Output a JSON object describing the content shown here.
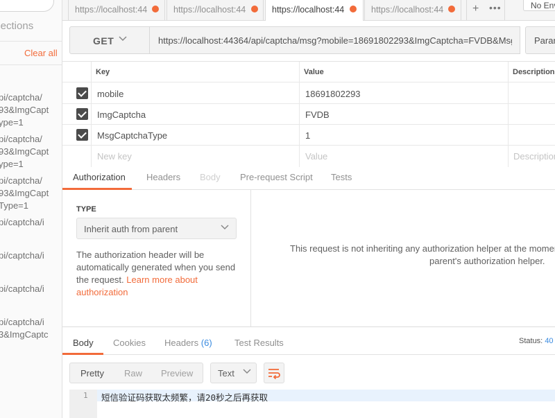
{
  "sidebar": {
    "collections_label": "llections",
    "clear_all_label": "Clear all",
    "history_lines": [
      "pi/captcha/",
      "93&ImgCapt",
      "ype=1",
      "pi/captcha/",
      "93&ImgCapt",
      "ype=1",
      "pi/captcha/",
      "93&ImgCapt",
      "Type=1",
      "pi/captcha/i",
      "pi/captcha/i",
      "pi/captcha/i",
      "pi/captcha/i",
      "3&ImgCaptc"
    ]
  },
  "tabs": [
    {
      "label": "https://localhost:44"
    },
    {
      "label": "https://localhost:44"
    },
    {
      "label": "https://localhost:44"
    },
    {
      "label": "https://localhost:44"
    }
  ],
  "environment": {
    "label": "No Env"
  },
  "request": {
    "method": "GET",
    "url": "https://localhost:44364/api/captcha/msg?mobile=18691802293&ImgCaptcha=FVDB&MsgC...",
    "params_label": "Param"
  },
  "params": {
    "headers": {
      "key": "Key",
      "value": "Value",
      "description": "Description"
    },
    "rows": [
      {
        "key": "mobile",
        "value": "18691802293"
      },
      {
        "key": "ImgCaptcha",
        "value": "FVDB"
      },
      {
        "key": "MsgCaptchaType",
        "value": "1"
      }
    ],
    "placeholder": {
      "key": "New key",
      "value": "Value",
      "description": "Description"
    }
  },
  "request_tabs": [
    "Authorization",
    "Headers",
    "Body",
    "Pre-request Script",
    "Tests"
  ],
  "auth": {
    "type_label": "TYPE",
    "type_value": "Inherit auth from parent",
    "description": "The authorization header will be automatically generated when you send the request.",
    "learn_more": "Learn more about authorization",
    "info_line1": "This request is not inheriting any authorization helper at the moment",
    "info_line2": "parent's authorization helper."
  },
  "response": {
    "tabs": {
      "body": "Body",
      "cookies": "Cookies",
      "headers": "Headers",
      "headers_count": "(6)",
      "tests": "Test Results"
    },
    "status_label": "Status:",
    "status_value": "40",
    "formats": [
      "Pretty",
      "Raw",
      "Preview"
    ],
    "text_type": "Text",
    "line_number": "1",
    "body_text": "短信验证码获取太频繁，请20秒之后再获取"
  },
  "colors": {
    "accent": "#f26b3a",
    "link_blue": "#3a8be0"
  }
}
